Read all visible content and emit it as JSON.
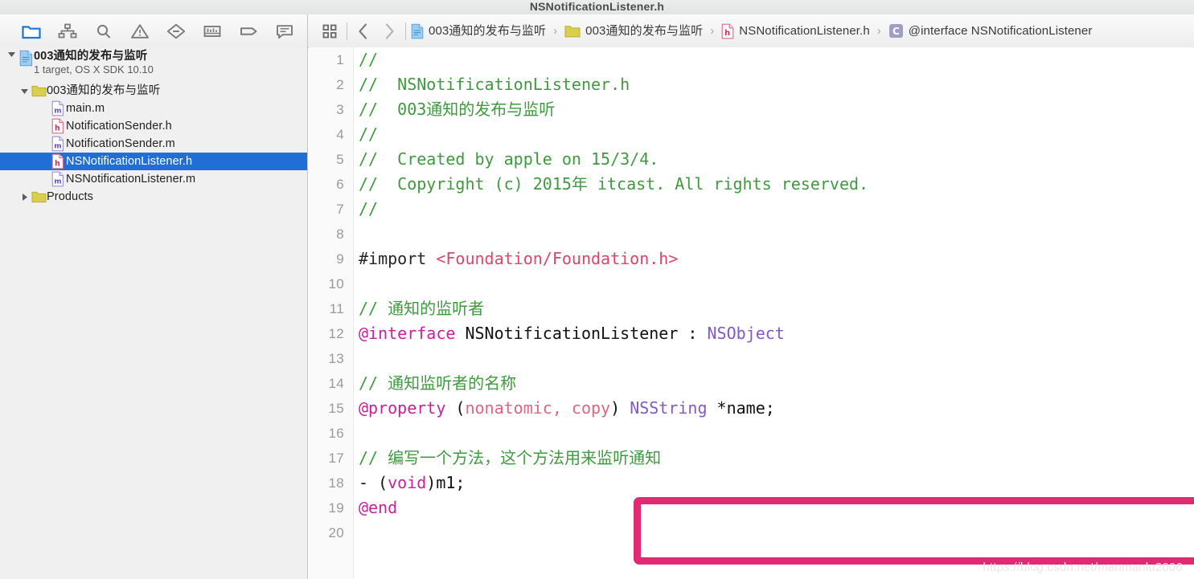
{
  "window": {
    "title": "NSNotificationListener.h"
  },
  "navigator_toolbar": {
    "icons": [
      {
        "name": "folder-icon",
        "label": "Project navigator",
        "active": true
      },
      {
        "name": "hierarchy-icon",
        "label": "Symbol navigator",
        "active": false
      },
      {
        "name": "search-icon",
        "label": "Find navigator",
        "active": false
      },
      {
        "name": "warning-triangle-icon",
        "label": "Issue navigator",
        "active": false
      },
      {
        "name": "diamond-minus-icon",
        "label": "Test navigator",
        "active": false
      },
      {
        "name": "debug-gauge-icon",
        "label": "Debug navigator",
        "active": false
      },
      {
        "name": "breakpoint-tag-icon",
        "label": "Breakpoint navigator",
        "active": false
      },
      {
        "name": "report-message-icon",
        "label": "Report navigator",
        "active": false
      }
    ]
  },
  "breadcrumb": {
    "jump_bar_icon": "grid-icon",
    "back_label": "‹",
    "forward_label": "›",
    "separator": "›",
    "segments": [
      {
        "icon": "project-file-icon",
        "label": "003通知的发布与监听"
      },
      {
        "icon": "folder-icon",
        "label": "003通知的发布与监听"
      },
      {
        "icon": "header-file-icon",
        "label": "NSNotificationListener.h"
      },
      {
        "icon": "interface-symbol-icon",
        "label": "@interface NSNotificationListener"
      }
    ]
  },
  "sidebar": {
    "root": {
      "name": "003通知的发布与监听",
      "subtitle": "1 target, OS X SDK 10.10",
      "icon": "project-file-icon",
      "expanded": true
    },
    "items": [
      {
        "label": "003通知的发布与监听",
        "icon": "folder-icon",
        "indent": 1,
        "expanded": true,
        "twisty": true,
        "selected": false
      },
      {
        "label": "main.m",
        "icon": "m-file-icon",
        "indent": 2,
        "twisty": false,
        "selected": false
      },
      {
        "label": "NotificationSender.h",
        "icon": "h-file-icon",
        "indent": 2,
        "twisty": false,
        "selected": false
      },
      {
        "label": "NotificationSender.m",
        "icon": "m-file-icon",
        "indent": 2,
        "twisty": false,
        "selected": false
      },
      {
        "label": "NSNotificationListener.h",
        "icon": "h-file-icon",
        "indent": 2,
        "twisty": false,
        "selected": true
      },
      {
        "label": "NSNotificationListener.m",
        "icon": "m-file-icon",
        "indent": 2,
        "twisty": false,
        "selected": false
      },
      {
        "label": "Products",
        "icon": "folder-icon",
        "indent": 1,
        "expanded": false,
        "twisty": true,
        "selected": false
      }
    ]
  },
  "editor": {
    "lines": [
      {
        "n": "1",
        "tokens": [
          {
            "t": "//",
            "c": "com"
          }
        ]
      },
      {
        "n": "2",
        "tokens": [
          {
            "t": "//  NSNotificationListener.h",
            "c": "com"
          }
        ]
      },
      {
        "n": "3",
        "tokens": [
          {
            "t": "//  003通知的发布与监听",
            "c": "com"
          }
        ]
      },
      {
        "n": "4",
        "tokens": [
          {
            "t": "//",
            "c": "com"
          }
        ]
      },
      {
        "n": "5",
        "tokens": [
          {
            "t": "//  Created by apple on 15/3/4.",
            "c": "com"
          }
        ]
      },
      {
        "n": "6",
        "tokens": [
          {
            "t": "//  Copyright (c) 2015年 itcast. All rights reserved.",
            "c": "com"
          }
        ]
      },
      {
        "n": "7",
        "tokens": [
          {
            "t": "//",
            "c": "com"
          }
        ]
      },
      {
        "n": "8",
        "tokens": []
      },
      {
        "n": "9",
        "tokens": [
          {
            "t": "#import ",
            "c": "pre"
          },
          {
            "t": "<Foundation/Foundation.h>",
            "c": "str"
          }
        ]
      },
      {
        "n": "10",
        "tokens": []
      },
      {
        "n": "11",
        "tokens": [
          {
            "t": "// 通知的监听者",
            "c": "com"
          }
        ]
      },
      {
        "n": "12",
        "tokens": [
          {
            "t": "@interface",
            "c": "key"
          },
          {
            "t": " NSNotificationListener : ",
            "c": "pln"
          },
          {
            "t": "NSObject",
            "c": "cls"
          }
        ]
      },
      {
        "n": "13",
        "tokens": []
      },
      {
        "n": "14",
        "tokens": [
          {
            "t": "// 通知监听者的名称",
            "c": "com"
          }
        ]
      },
      {
        "n": "15",
        "tokens": [
          {
            "t": "@property",
            "c": "key"
          },
          {
            "t": " (",
            "c": "pln"
          },
          {
            "t": "nonatomic, copy",
            "c": "attr"
          },
          {
            "t": ") ",
            "c": "pln"
          },
          {
            "t": "NSString",
            "c": "cls"
          },
          {
            "t": " *name;",
            "c": "pln"
          }
        ]
      },
      {
        "n": "16",
        "tokens": []
      },
      {
        "n": "17",
        "tokens": [
          {
            "t": "// 编写一个方法，这个方法用来监听通知",
            "c": "com"
          }
        ]
      },
      {
        "n": "18",
        "tokens": [
          {
            "t": "- (",
            "c": "pln"
          },
          {
            "t": "void",
            "c": "key"
          },
          {
            "t": ")m1;",
            "c": "pln"
          }
        ]
      },
      {
        "n": "19",
        "tokens": [
          {
            "t": "@end",
            "c": "key"
          }
        ]
      },
      {
        "n": "20",
        "tokens": []
      }
    ],
    "annotation": {
      "shape": "rectangle",
      "color": "#e02b72",
      "covers_lines": [
        "17",
        "18"
      ]
    }
  },
  "watermark": {
    "text": "https://blog.csdn.net/manmanlu2006"
  },
  "colors": {
    "selection_blue": "#1f6fd6",
    "comment_green": "#3f9a3f",
    "keyword_magenta": "#c9219b",
    "class_purple": "#8359c4",
    "string_red": "#d9476b",
    "annotation_pink": "#e02b72"
  }
}
